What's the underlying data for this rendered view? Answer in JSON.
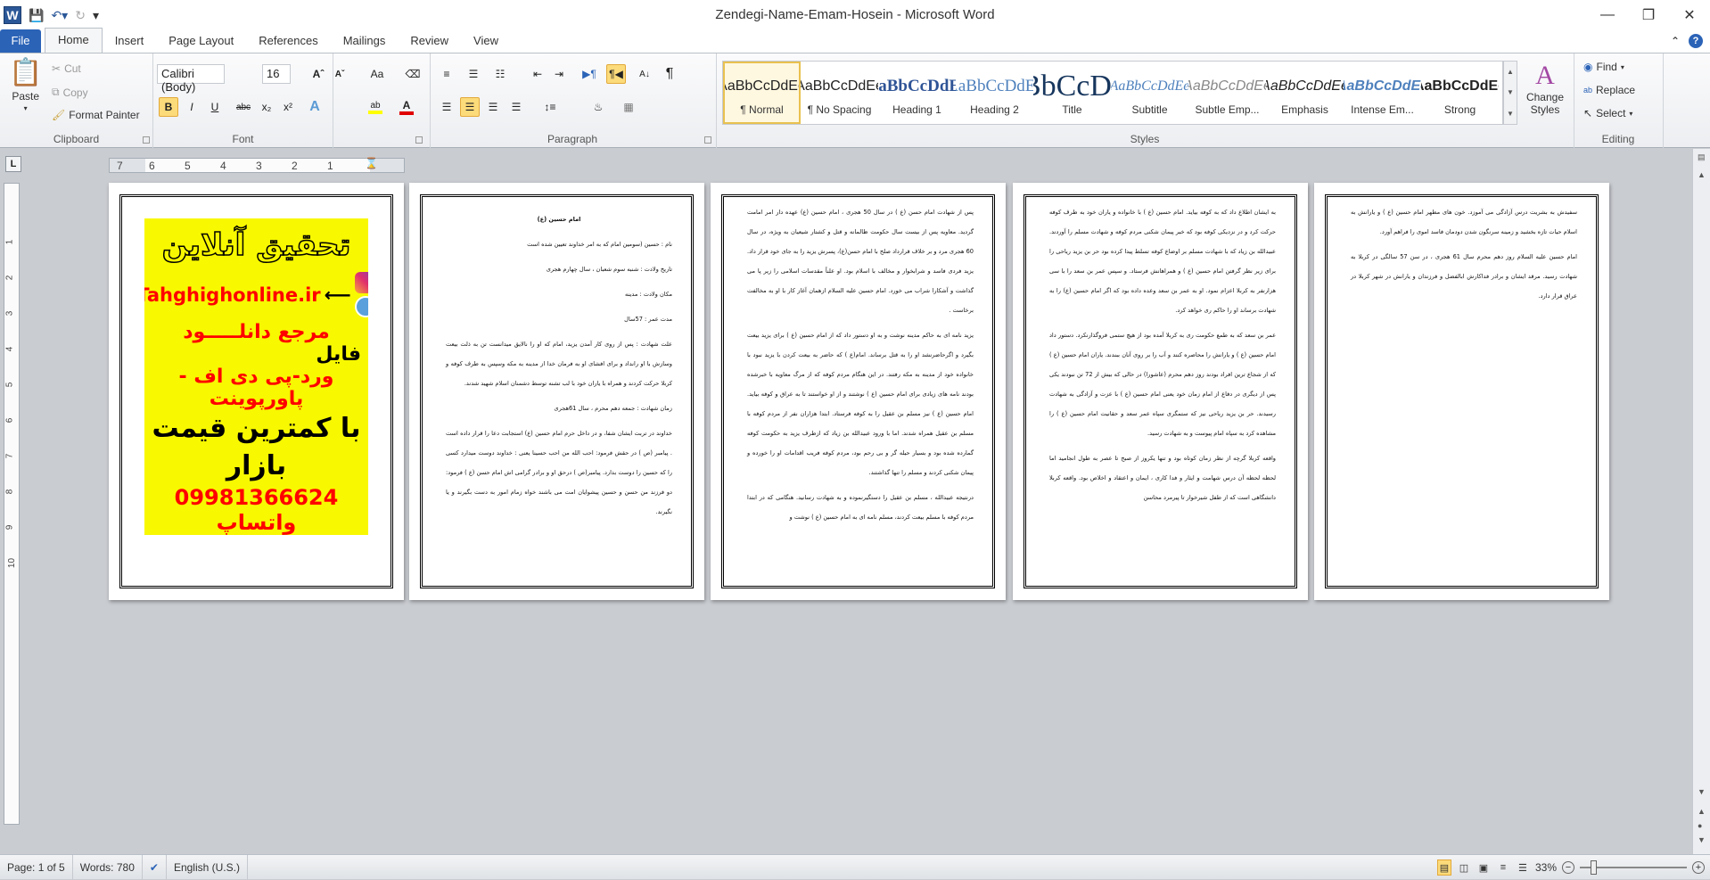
{
  "window": {
    "title": "Zendegi-Name-Emam-Hosein  -  Microsoft Word",
    "app_icon": "W"
  },
  "tabs": [
    {
      "label": "File"
    },
    {
      "label": "Home"
    },
    {
      "label": "Insert"
    },
    {
      "label": "Page Layout"
    },
    {
      "label": "References"
    },
    {
      "label": "Mailings"
    },
    {
      "label": "Review"
    },
    {
      "label": "View"
    }
  ],
  "clipboard": {
    "paste": "Paste",
    "cut": "Cut",
    "copy": "Copy",
    "format_painter": "Format Painter",
    "label": "Clipboard"
  },
  "font": {
    "name": "Calibri (Body)",
    "size": "16",
    "label": "Font",
    "bold": "B",
    "italic": "I",
    "underline": "U",
    "strike": "abc",
    "sub": "x₂",
    "sup": "x²",
    "case": "Aa",
    "highlight_color": "#ffff00",
    "font_color": "#e00000"
  },
  "paragraph": {
    "label": "Paragraph"
  },
  "styles": {
    "label": "Styles",
    "items": [
      {
        "preview": "AaBbCcDdEe",
        "name": "¶ Normal"
      },
      {
        "preview": "AaBbCcDdEe",
        "name": "¶ No Spacing"
      },
      {
        "preview": "AaBbCcDdEe",
        "name": "Heading 1"
      },
      {
        "preview": "AaBbCcDdEe",
        "name": "Heading 2"
      },
      {
        "preview": "AaBbCcDdEe",
        "name": "Title"
      },
      {
        "preview": "AaBbCcDdEe",
        "name": "Subtitle"
      },
      {
        "preview": "AaBbCcDdEe",
        "name": "Subtle Emp..."
      },
      {
        "preview": "AaBbCcDdEe",
        "name": "Emphasis"
      },
      {
        "preview": "AaBbCcDdEe",
        "name": "Intense Em..."
      },
      {
        "preview": "AaBbCcDdEe",
        "name": "Strong"
      }
    ],
    "change_styles": "Change Styles"
  },
  "editing": {
    "label": "Editing",
    "find": "Find",
    "replace": "Replace",
    "select": "Select"
  },
  "ruler": {
    "ticks": [
      "7",
      "6",
      "5",
      "4",
      "3",
      "2",
      "1"
    ],
    "vticks": [
      "1",
      "2",
      "3",
      "4",
      "5",
      "6",
      "7",
      "8",
      "9",
      "10"
    ]
  },
  "pages": {
    "p1": {
      "ad": {
        "title": "تحقیق آنلاین",
        "site": "Tahghighonline.ir",
        "line3": "مرجع دانلـــــود",
        "line4": "فایل",
        "line5": "ورد-پی دی اف - پاورپوینت",
        "line6": "با کمترین قیمت بازار",
        "line7": "09981366624 واتساپ"
      }
    },
    "p2": {
      "title": "امام حسین (ع)",
      "paras": [
        "نام : حسین (سومین امام که به امر خداوند تعیین شده است",
        "تاریخ ولادت : شنبه سوم شعبان ، سال چهارم هجری",
        "مکان ولادت : مدینه",
        "مدت عمر : 57سال",
        "علت شهادت : پس از روی کار آمدن یزید، امام که او را نالایق میدانست تن به ذلت بیعت وسازش با او رانداد و برای افشای او به فرمان خدا از مدینه به مکه وسپس به طرف کوفه و کربلا حرکت کردند و همراه با یاران خود با لب تشنه توسط دشمنان اسلام شهید شدند.",
        "زمان شهادت : جمعه دهم محرم ، سال 61هجری",
        "خداوند در تربت ایشان شفا، و در داخل حرم امام حسین (ع) استجابت دعا را قرار داده است . پیامبر (ص ) در حقش فرمود: احب الله من احب حسینا یعنی : خداوند دوست میدارد کسی را که حسین را دوست بدارد. پیامبر(ص ) درحق او و برادر گرامی اش امام حسن (ع ) فرمود: دو فرزند من حسن و حسین پیشوایان امت می باشند خواه زمام امور به دست بگیرند و یا نگیرند."
      ]
    },
    "p3": {
      "paras": [
        "پس از شهادت امام حسن (ع ) در سال 50 هجری ، امام حسین (ع) عهده دار امر امامت گردید. معاویه پس از بیست سال حکومت ظالمانه و قتل و کشتار شیعیان به ویژه، در سال 60 هجری مرد و بر خلاف قرارداد صلح با امام حسن(ع)، پسرش یزید را به جای خود قرار داد. یزید فردی فاسد و شرابخوار و مخالف با اسلام بود. او علناً مقدسات اسلامی را زیر پا می گذاشت و آشکارا شراب می خورد. امام حسین علیه السلام ازهمان آغاز کار با او به مخالفت برخاست .",
        "یزید نامه ای به حاکم مدینه نوشت و به او دستور داد که از امام حسین (ع ) برای یزید بیعت بگیرد و اگرحاضرنشد او را به قتل برساند. امام(ع ) که حاضر به بیعت کردن با یزید نبود با خانواده خود از مدینه به مکه رفتند. در این هنگام مردم کوفه که از مرگ معاویه با خبرشده بودند نامه های زیادی برای امام حسین (ع ) نوشتند و از او خواستند تا به عراق و کوفه بیاید. امام حسین (ع ) نیز مسلم بن عقیل را به کوفه فرستاد. ابتدا هزاران نفر از مردم کوفه با مسلم بن عقیل همراه شدند. اما با ورود عبیدالله بن زیاد که ازطرف یزید به حکومت کوفه گمارده شده بود و بسیار حیله گر و بی رحم بود، مردم کوفه فریب اقدامات او را خورده و پیمان شکنی کردند و مسلم را تنها گذاشتند.",
        "درنتیجه عبیدالله ، مسلم بن عقیل را دستگیرنموده و به شهادت رسانید. هنگامی که در ابتدا مردم کوفه با مسلم بیعت کردند، مسلم نامه ای به امام حسین (ع ) نوشت و"
      ]
    },
    "p4": {
      "paras": [
        "به ایشان اطلاع داد که به کوفه بیاید. امام حسین (ع ) با خانواده و یاران خود به طرف کوفه حرکت کرد و در نزدیکی کوفه بود که خبر پیمان شکنی مردم کوفه و شهادت مسلم را آوردند. عبیدالله بن زیاد که با شهادت مسلم بر اوضاع کوفه تسلط پیدا کرده بود حر بن یزید ریاحی را برای زیر نظر گرفتن امام حسین (ع ) و همراهانش فرستاد. و سپس عمر بن سعد را با سی هزارنفر به کربلا اعزام نمود. او به عمر بن سعد وعده داده بود که اگر امام حسین (ع) را به شهادت برساند او را حاکم ری خواهد کرد.",
        "عمر بن سعد که به طمع حکومت ری به کربلا آمده بود از هیچ ستمی فروگذارنکرد. دستور داد امام حسین (ع ) و یارانش را محاصره کنند و آب را بر روی آنان ببندند. یاران امام حسین (ع ) که از شجاع ترین افراد بودند روز دهم محرم (عاشورا) در حالی که بیش از 72 تن نبودند یکی پس از دیگری در دفاع از امام زمان خود یعنی امام حسین (ع ) با عزت و آزادگی به شهادت رسیدند. حر بن یزید ریاحی نیز که ستمگری سپاه عمر سعد و حقانیت امام حسین (ع ) را مشاهده کرد به سپاه امام پیوست و به شهادت رسید.",
        "واقعه کربلا گرچه از نظر زمان کوتاه بود و تنها یکروز از صبح تا عصر به طول انجامید اما لحظه لحظه آن درس شهامت و ایثار و فدا کاری ، ایمان و اعتقاد و اخلاص بود. واقعه کربلا دانشگاهی است که از طفل شیرخوار تا پیرمرد محاسن"
      ]
    },
    "p5": {
      "paras": [
        "سفیدش به بشریت درس آزادگی می آموزد. خون های مطهر امام حسین (ع ) و یارانش به اسلام حیات تازه بخشید و زمینه سرنگون شدن دودمان فاسد اموی را فراهم آورد.",
        "امام حسین علیه السلام روز دهم محرم سال 61 هجری ، در سن 57 سالگی در کربلا به شهادت رسید. مرقد ایشان و برادر فداکارش ابالفضل و فرزندان و یارانش در شهر کربلا در عراق قرار دارد."
      ]
    }
  },
  "status": {
    "page": "Page: 1 of 5",
    "words": "Words: 780",
    "language": "English (U.S.)",
    "zoom": "33%",
    "zoom_percent": 33
  }
}
